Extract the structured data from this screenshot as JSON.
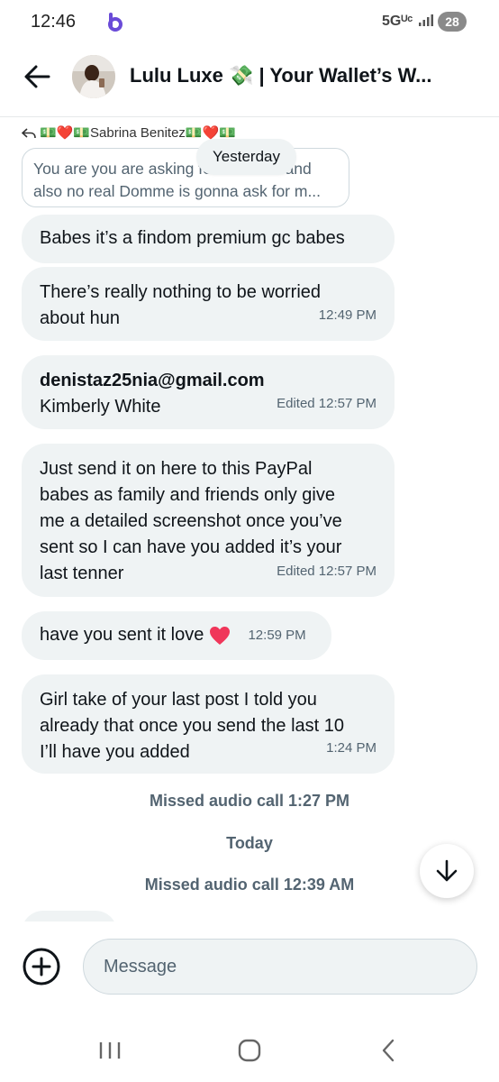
{
  "status_bar": {
    "time": "12:46",
    "network": "5Gᵁᶜ",
    "battery": "28"
  },
  "header": {
    "title": "Lulu Luxe 💸 | Your Wallet’s W..."
  },
  "reply": {
    "to": "💵❤️💵Sabrina Benitez💵❤️💵",
    "line1": "You are you are asking for GCs like and",
    "line2": "also no real Domme is gonna ask for m..."
  },
  "date_separator": "Yesterday",
  "messages": [
    {
      "text": "Babes it’s a findom premium gc babes"
    },
    {
      "line1": "There’s really nothing to be worried",
      "line2": "about hun",
      "time": "12:49 PM"
    },
    {
      "email": "denistaz25nia@gmail.com",
      "name": "Kimberly White",
      "time": "Edited 12:57 PM"
    },
    {
      "line1": "Just send it on here to this PayPal",
      "line2": "babes as family and friends only give",
      "line3": "me a detailed screenshot once you’ve",
      "line4": "sent so I can have you added it’s your",
      "line5": "last tenner",
      "time": "Edited 12:57 PM"
    },
    {
      "text": "have you sent it love",
      "time": "12:59 PM"
    },
    {
      "line1": "Girl take of your last post I told you",
      "line2": "already that once you send the last 10",
      "line3": "I’ll have you added",
      "time": "1:24 PM"
    }
  ],
  "system": {
    "missed_call_1": "Missed audio call 1:27 PM",
    "today": "Today",
    "missed_call_2": "Missed audio call 12:39 AM"
  },
  "composer": {
    "placeholder": "Message"
  },
  "icons": [
    "back-arrow-icon",
    "add-circle-icon",
    "scroll-down-arrow-icon",
    "heart-icon",
    "reply-arrow-icon",
    "recents-icon",
    "home-icon",
    "nav-back-icon"
  ],
  "colors": {
    "bubble": "#eff3f4",
    "secondary_text": "#536471",
    "heart": "#f0365a"
  }
}
